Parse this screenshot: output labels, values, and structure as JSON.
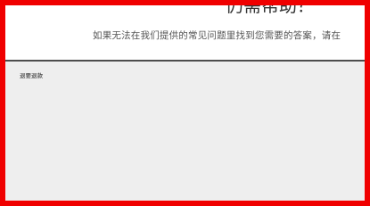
{
  "help": {
    "title": "仍需帮助？",
    "text": "如果无法在我们提供的常见问题里找到您需要的答案，请在"
  },
  "panel": {
    "label": "退要退款"
  },
  "colors": {
    "frame_border": "#f00000",
    "panel_background": "#eeeeee",
    "divider": "#4d4d4d"
  }
}
